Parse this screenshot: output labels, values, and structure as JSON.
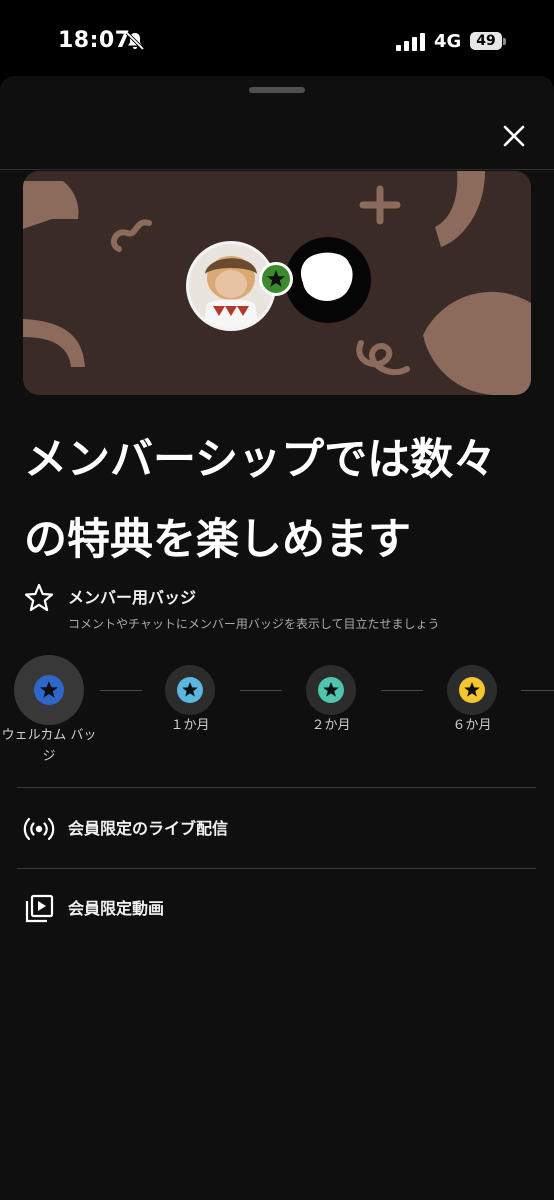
{
  "status_bar": {
    "time": "18:07",
    "network": "4G",
    "battery": "49"
  },
  "banner": {
    "background_color": "#3a2b27",
    "accent_color": "#8c6a5c",
    "join_badge_color": "#3c8a2e"
  },
  "headline": "メンバーシップでは数々の特典を楽しめます",
  "perks": {
    "badges": {
      "title": "メンバー用バッジ",
      "description": "コメントやチャットにメンバー用バッジを表示して目立たせましょう",
      "icon": "star-outline-icon",
      "tiers": [
        {
          "label": "ウェルカム バッジ",
          "color": "#2f66c9",
          "selected": true
        },
        {
          "label": "１か月",
          "color": "#5bb6e0",
          "selected": false
        },
        {
          "label": "２か月",
          "color": "#4fc5ae",
          "selected": false
        },
        {
          "label": "６か月",
          "color": "#f2c531",
          "selected": false
        }
      ]
    },
    "live": {
      "title": "会員限定のライブ配信",
      "icon": "live-broadcast-icon"
    },
    "videos": {
      "title": "会員限定動画",
      "icon": "video-library-icon"
    }
  }
}
